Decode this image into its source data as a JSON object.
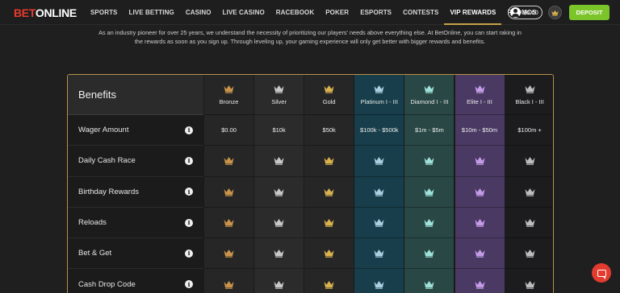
{
  "brand": {
    "bet": "BET",
    "online": "ONLINE"
  },
  "nav": [
    "SPORTS",
    "LIVE BETTING",
    "CASINO",
    "LIVE CASINO",
    "RACEBOOK",
    "POKER",
    "ESPORTS",
    "CONTESTS",
    "VIP REWARDS",
    "PROMOS"
  ],
  "nav_active": "VIP REWARDS",
  "account": {
    "balance": "$0.00",
    "deposit_label": "DEPOSIT"
  },
  "intro": "As an industry pioneer for over 25 years, we understand the necessity of prioritizing our players' needs above everything else. At BetOnline, you can start raking in the rewards as soon as you sign up. Through leveling up, your gaming experience will only get better with bigger rewards and benefits.",
  "table": {
    "header": "Benefits",
    "rows": [
      "Wager Amount",
      "Daily Cash Race",
      "Birthday Rewards",
      "Reloads",
      "Bet & Get",
      "Cash Drop Code"
    ],
    "tiers": [
      {
        "name": "Bronze",
        "wager": "$0.00",
        "bg": "#262626",
        "crown": "#c9944a"
      },
      {
        "name": "Silver",
        "wager": "$10k",
        "bg": "#2b2b2b",
        "crown": "#c8c8c8"
      },
      {
        "name": "Gold",
        "wager": "$50k",
        "bg": "#262626",
        "crown": "#d9b24e"
      },
      {
        "name": "Platinum I - III",
        "wager": "$100k - $500k",
        "bg": "#173e4a",
        "crown": "#a9cfe0"
      },
      {
        "name": "Diamond I - III",
        "wager": "$1m - $5m",
        "bg": "#284745",
        "crown": "#9fe0d8"
      },
      {
        "name": "Elite I - III",
        "wager": "$10m - $50m",
        "bg": "#4a3a63",
        "crown": "#c59be8"
      },
      {
        "name": "Black I - III",
        "wager": "$100m +",
        "bg": "#1c1c1e",
        "crown": "#bdbdbd"
      }
    ]
  },
  "icons": {
    "info": "info-icon",
    "crown": "crown-icon",
    "user": "user-icon",
    "chat": "chat-icon"
  },
  "colors": {
    "brand_red": "#e8392f",
    "deposit_green": "#7bc42a",
    "table_border": "#b8924a"
  }
}
